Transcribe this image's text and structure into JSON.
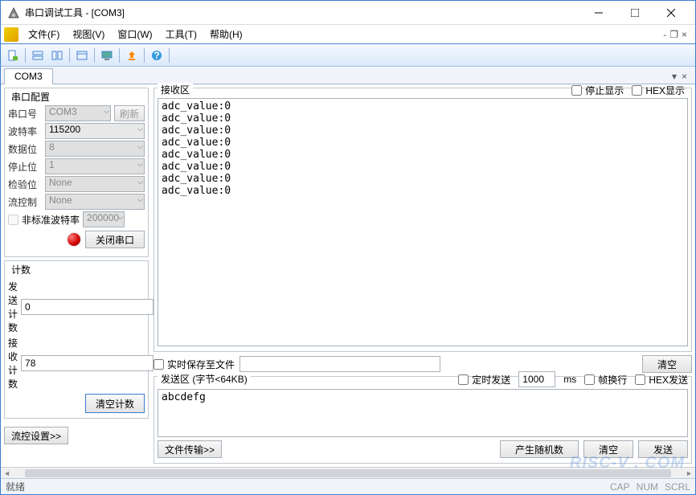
{
  "window": {
    "title": "串口调试工具 - [COM3]"
  },
  "menu": {
    "file": "文件(F)",
    "view": "视图(V)",
    "window": "窗口(W)",
    "tool": "工具(T)",
    "help": "帮助(H)"
  },
  "tab": {
    "name": "COM3"
  },
  "config": {
    "legend": "串口配置",
    "port_label": "串口号",
    "port_value": "COM3",
    "refresh_btn": "刷新",
    "baud_label": "波特率",
    "baud_value": "115200",
    "data_label": "数据位",
    "data_value": "8",
    "stop_label": "停止位",
    "stop_value": "1",
    "parity_label": "检验位",
    "parity_value": "None",
    "flow_label": "流控制",
    "flow_value": "None",
    "nonstd_label": "非标准波特率",
    "nonstd_value": "200000",
    "close_port_btn": "关闭串口"
  },
  "counter": {
    "legend": "计数",
    "send_label": "发送计数",
    "send_value": "0",
    "recv_label": "接收计数",
    "recv_value": "78",
    "clear_btn": "清空计数"
  },
  "flow_settings_btn": "流控设置>>",
  "recv": {
    "legend": "接收区",
    "pause_label": "停止显示",
    "hex_label": "HEX显示",
    "content": "adc_value:0\nadc_value:0\nadc_value:0\nadc_value:0\nadc_value:0\nadc_value:0\nadc_value:0\nadc_value:0",
    "save_realtime_label": "实时保存至文件",
    "clear_btn": "清空"
  },
  "send": {
    "legend": "发送区 (字节<64KB)",
    "timer_label": "定时发送",
    "interval_value": "1000",
    "interval_unit": "ms",
    "wrap_label": "帧换行",
    "hex_label": "HEX发送",
    "content": "abcdefg",
    "file_transfer_btn": "文件传输>>",
    "random_btn": "产生随机数",
    "clear_btn": "清空",
    "send_btn": "发送"
  },
  "statusbar": {
    "ready": "就绪",
    "cap": "CAP",
    "num": "NUM",
    "scrl": "SCRL"
  },
  "watermark": "RISC-V . COM"
}
